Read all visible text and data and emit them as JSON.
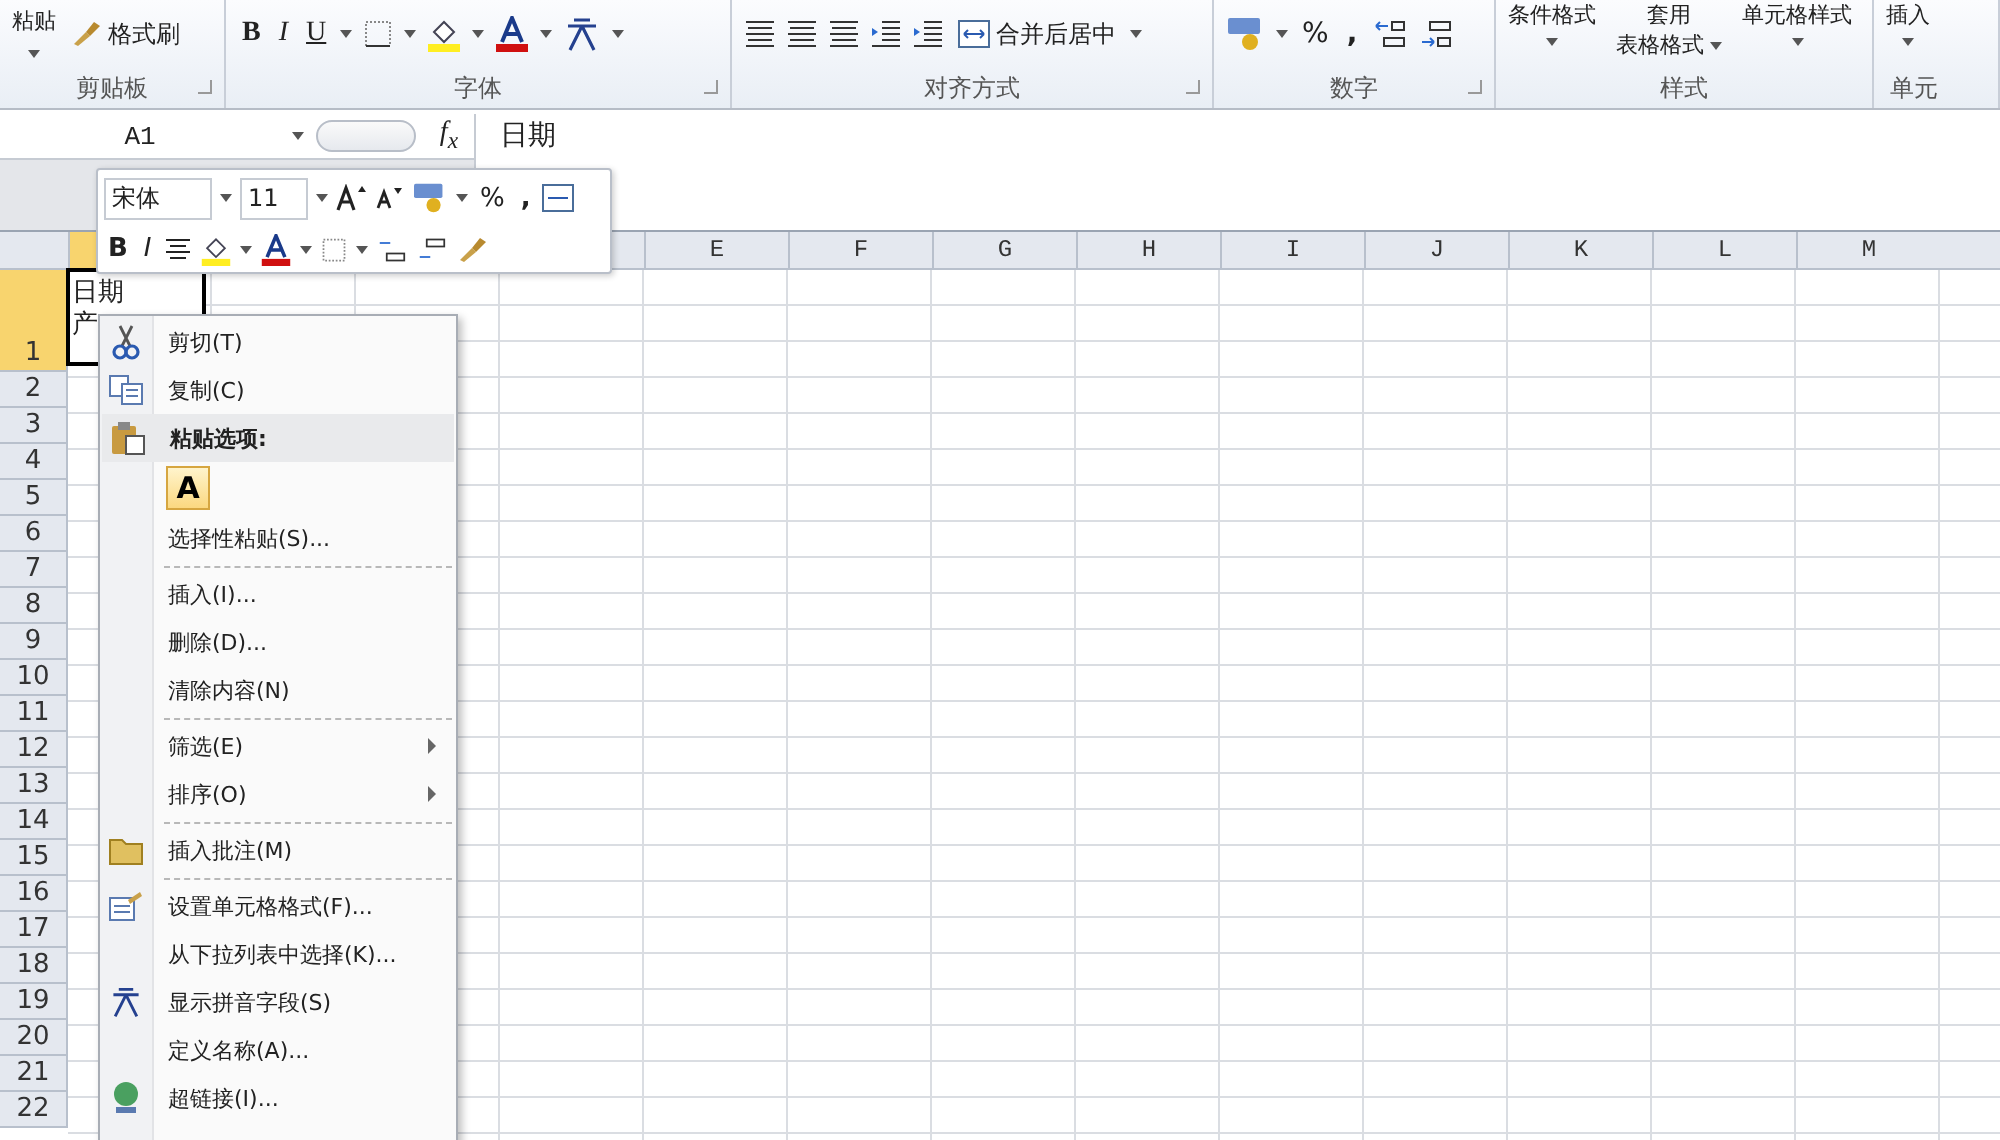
{
  "ribbon": {
    "paste": "粘贴",
    "format_painter": "格式刷",
    "bold": "B",
    "italic": "I",
    "underline": "U",
    "merge_center": "合并后居中",
    "percent": "%",
    "comma": ",",
    "conditional_format": "条件格式",
    "table_format_top": "套用",
    "table_format": "表格格式",
    "cell_styles": "单元格样式",
    "insert": "插入",
    "groups": [
      "剪贴板",
      "字体",
      "对齐方式",
      "数字",
      "样式",
      "单元"
    ]
  },
  "formula_bar": {
    "name_box": "A1",
    "fx": "*f*$_{x}$",
    "content": "日期"
  },
  "mini_toolbar": {
    "font": "宋体",
    "size": "11",
    "percent": "%",
    "comma": ",",
    "bold": "B",
    "italic": "I"
  },
  "columns": [
    "E",
    "F",
    "G",
    "H",
    "I",
    "J",
    "K",
    "L",
    "M"
  ],
  "rows": [
    "1",
    "2",
    "3",
    "4",
    "5",
    "6",
    "7",
    "8",
    "9",
    "10",
    "11",
    "12",
    "13",
    "14",
    "15",
    "16",
    "17",
    "18",
    "19",
    "20",
    "21",
    "22"
  ],
  "cell_a1": [
    "日期",
    "产"
  ],
  "context_menu": [
    {
      "kind": "item",
      "label": "剪切(T)",
      "divider": false
    },
    {
      "kind": "item",
      "label": "复制(C)",
      "divider": false
    },
    {
      "kind": "header",
      "label": "粘贴选项:",
      "divider": false
    },
    {
      "kind": "paste_option",
      "label": "A",
      "divider": false
    },
    {
      "kind": "item",
      "label": "选择性粘贴(S)...",
      "divider": true
    },
    {
      "kind": "item",
      "label": "插入(I)...",
      "divider": false
    },
    {
      "kind": "item",
      "label": "删除(D)...",
      "divider": false
    },
    {
      "kind": "item",
      "label": "清除内容(N)",
      "divider": true
    },
    {
      "kind": "submenu",
      "label": "筛选(E)",
      "divider": false
    },
    {
      "kind": "submenu",
      "label": "排序(O)",
      "divider": true
    },
    {
      "kind": "item",
      "label": "插入批注(M)",
      "divider": true
    },
    {
      "kind": "item",
      "label": "设置单元格格式(F)...",
      "divider": false
    },
    {
      "kind": "item",
      "label": "从下拉列表中选择(K)...",
      "divider": false
    },
    {
      "kind": "item",
      "label": "显示拼音字段(S)",
      "divider": false
    },
    {
      "kind": "item",
      "label": "定义名称(A)...",
      "divider": false
    },
    {
      "kind": "item",
      "label": "超链接(I)...",
      "divider": false
    }
  ]
}
